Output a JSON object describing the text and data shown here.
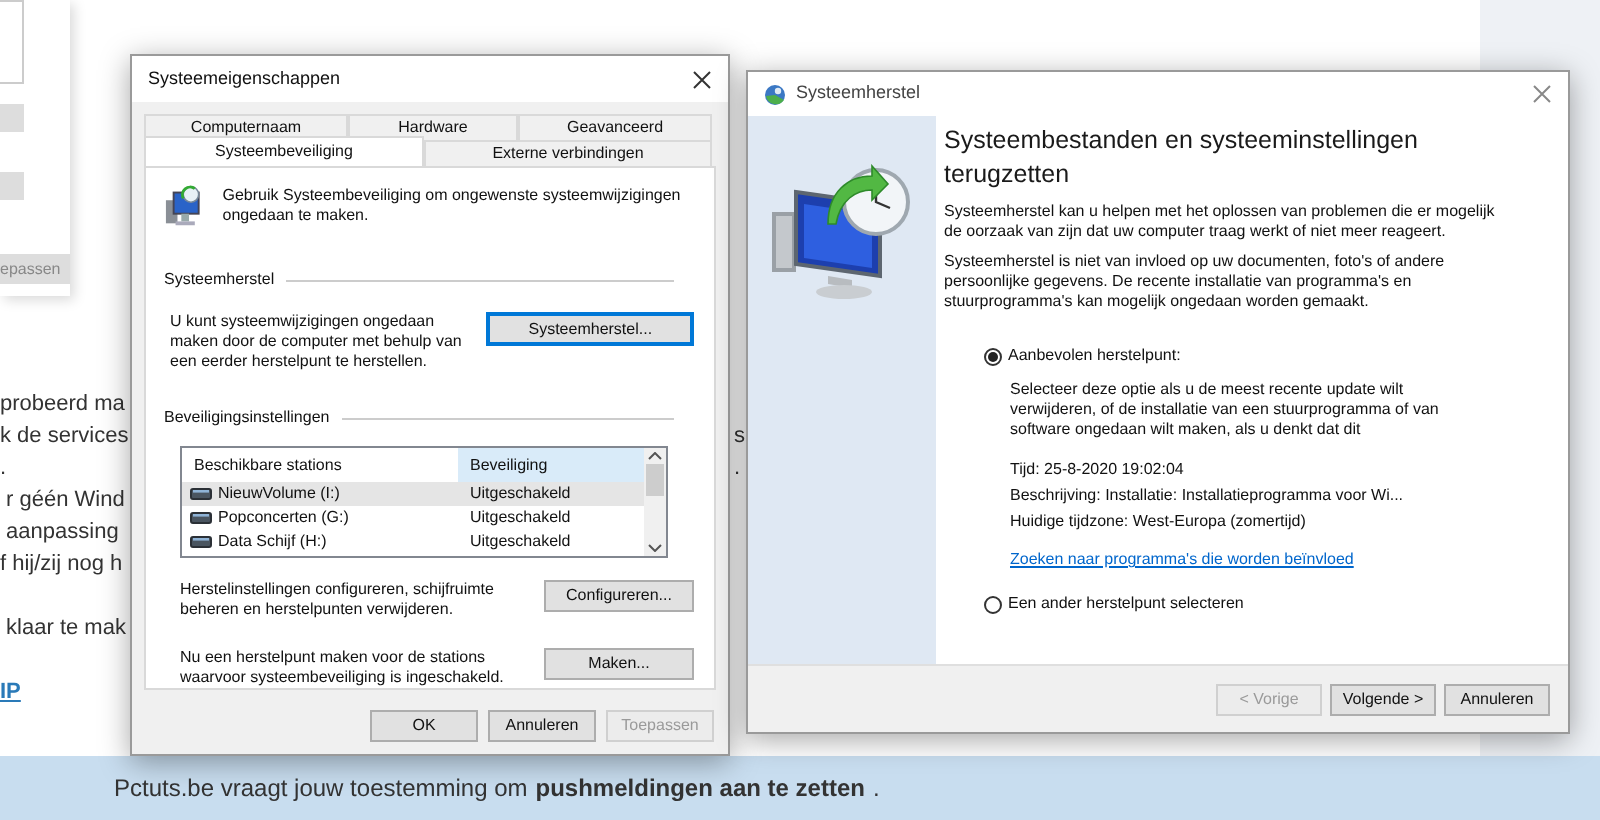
{
  "web_page": {
    "card_button": "epassen",
    "left_paragraphs": [
      [
        "probeerd ma",
        "k de services",
        ".",
        " r géén Wind",
        " aanpassing",
        "f hij/zij nog h"
      ],
      [
        " klaar te mak"
      ]
    ],
    "left_link": "IP",
    "right_fragments": [
      "s",
      "."
    ]
  },
  "properties_dialog": {
    "title": "Systeemeigenschappen",
    "tab_rows": [
      {
        "tabs": [
          {
            "label": "Computernaam",
            "selected": false
          },
          {
            "label": "Hardware",
            "selected": false
          },
          {
            "label": "Geavanceerd",
            "selected": false
          }
        ]
      },
      {
        "tabs": [
          {
            "label": "Systeembeveiliging",
            "selected": true
          },
          {
            "label": "Externe verbindingen",
            "selected": false
          }
        ]
      }
    ],
    "intro": "Gebruik Systeembeveiliging om ongewenste systeemwijzigingen ongedaan te maken.",
    "restore_section": {
      "heading": "Systeemherstel",
      "text": "U kunt systeemwijzigingen ongedaan maken door de computer met behulp van een eerder herstelpunt te herstellen.",
      "button": "Systeemherstel..."
    },
    "protection_section": {
      "heading": "Beveiligingsinstellingen",
      "columns": [
        "Beschikbare stations",
        "Beveiliging"
      ],
      "drives": [
        {
          "name": "NieuwVolume (I:)",
          "status": "Uitgeschakeld",
          "selected": true
        },
        {
          "name": "Popconcerten (G:)",
          "status": "Uitgeschakeld",
          "selected": false
        },
        {
          "name": "Data Schijf (H:)",
          "status": "Uitgeschakeld",
          "selected": false
        }
      ],
      "actions": [
        {
          "text": "Herstelinstellingen configureren, schijfruimte beheren en herstelpunten verwijderen.",
          "button": "Configureren..."
        },
        {
          "text": "Nu een herstelpunt maken voor de stations waarvoor systeembeveiliging is ingeschakeld.",
          "button": "Maken..."
        }
      ]
    },
    "buttons": [
      {
        "label": "OK",
        "disabled": false
      },
      {
        "label": "Annuleren",
        "disabled": false
      },
      {
        "label": "Toepassen",
        "disabled": true
      }
    ]
  },
  "restore_dialog": {
    "title": "Systeemherstel",
    "heading": "Systeembestanden en systeeminstellingen terugzetten",
    "paragraphs": [
      "Systeemherstel kan u helpen met het oplossen van problemen die er mogelijk de oorzaak van zijn dat uw computer traag werkt of niet meer reageert.",
      "Systeemherstel is niet van invloed op uw documenten, foto's of andere persoonlijke gegevens. De recente installatie van programma's en stuurprogramma's kan mogelijk ongedaan worden gemaakt."
    ],
    "options": [
      {
        "label": "Aanbevolen herstelpunt:",
        "selected": true,
        "description": "Selecteer deze optie als u de meest recente update wilt verwijderen, of de installatie van een stuurprogramma of van software ongedaan wilt maken, als u denkt dat dit",
        "details": [
          "Tijd: 25-8-2020 19:02:04",
          "Beschrijving: Installatie: Installatieprogramma voor Wi...",
          "Huidige tijdzone: West-Europa (zomertijd)"
        ],
        "link": "Zoeken naar programma's die worden beïnvloed"
      },
      {
        "label": "Een ander herstelpunt selecteren",
        "selected": false
      }
    ],
    "buttons": [
      {
        "label": "< Vorige",
        "disabled": true
      },
      {
        "label": "Volgende >",
        "disabled": false
      },
      {
        "label": "Annuleren",
        "disabled": false
      }
    ]
  },
  "banner": {
    "text": "Pctuts.be vraagt jouw toestemming om",
    "link": "pushmeldingen aan te zetten",
    "end": "."
  }
}
